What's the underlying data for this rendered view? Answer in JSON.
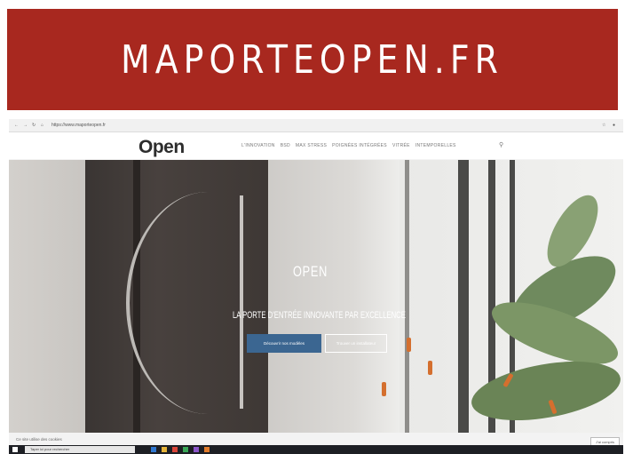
{
  "banner": {
    "title": "MAPORTEOPEN.FR"
  },
  "browser": {
    "url": "https://www.maporteopen.fr"
  },
  "site": {
    "logo": "Open",
    "nav": [
      "L'INNOVATION",
      "BSD",
      "MAX STRESS",
      "POIGNÉES INTÉGRÉES",
      "VITRÉE",
      "INTEMPORELLES"
    ],
    "search_icon": "search-icon"
  },
  "hero": {
    "title": "OPEN",
    "tagline": "LA PORTE D'ENTRÉE INNOVANTE PAR EXCELLENCE",
    "primary_button": "Découvrir nos modèles",
    "secondary_button": "Trouver un installateur"
  },
  "footer_bar": {
    "cookie_text": "Ce site utilise des cookies",
    "accept_label": "J'ai compris"
  },
  "taskbar": {
    "search_placeholder": "Taper ici pour rechercher"
  },
  "colors": {
    "banner": "#a8281f",
    "primary_button": "#3b6691"
  }
}
